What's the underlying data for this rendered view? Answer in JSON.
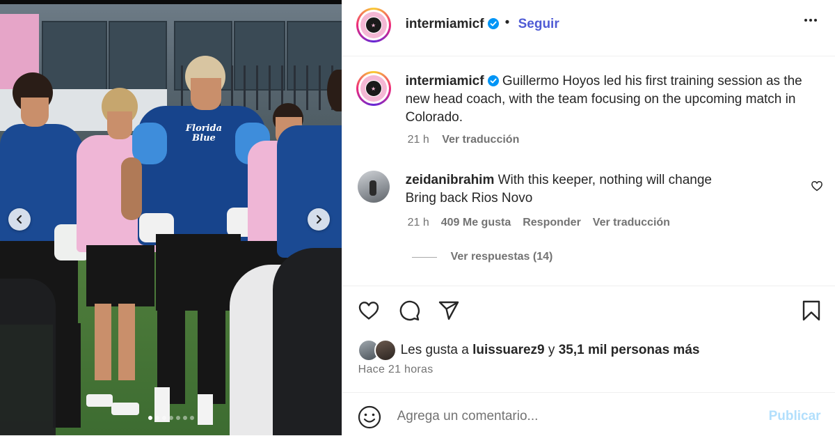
{
  "post": {
    "username": "intermiamicf",
    "follow_label": "Seguir",
    "separator": "•"
  },
  "caption": {
    "username": "intermiamicf",
    "text": "Guillermo Hoyos led his first training session as the new head coach, with the team focusing on the upcoming match in Colorado.",
    "time": "21 h",
    "translate_label": "Ver traducción"
  },
  "comment": {
    "username": "zeidanibrahim",
    "line1": "With this keeper, nothing will change",
    "line2": "Bring back Rios Novo",
    "time": "21 h",
    "likes": "409 Me gusta",
    "reply_label": "Responder",
    "translate_label": "Ver traducción",
    "view_replies": "Ver respuestas (14)"
  },
  "likes": {
    "prefix": "Les gusta a",
    "user": "luissuarez9",
    "connector": "y",
    "others": "35,1 mil personas más"
  },
  "timestamp": "Hace 21 horas",
  "composer": {
    "placeholder": "Agrega un comentario...",
    "post_label": "Publicar"
  },
  "image": {
    "jersey_text_1": "Florida",
    "jersey_text_2": "Blue",
    "carousel": {
      "total": 7,
      "active_index": 0
    }
  },
  "colors": {
    "follow": "#4f5bd5",
    "verified": "#0095f6",
    "publish_disabled": "#b2dffc",
    "muted": "#737373"
  },
  "icons": [
    "verified-icon",
    "more-options-icon",
    "heart-icon",
    "comment-icon",
    "share-icon",
    "bookmark-icon",
    "emoji-icon",
    "chevron-left-icon",
    "chevron-right-icon"
  ]
}
